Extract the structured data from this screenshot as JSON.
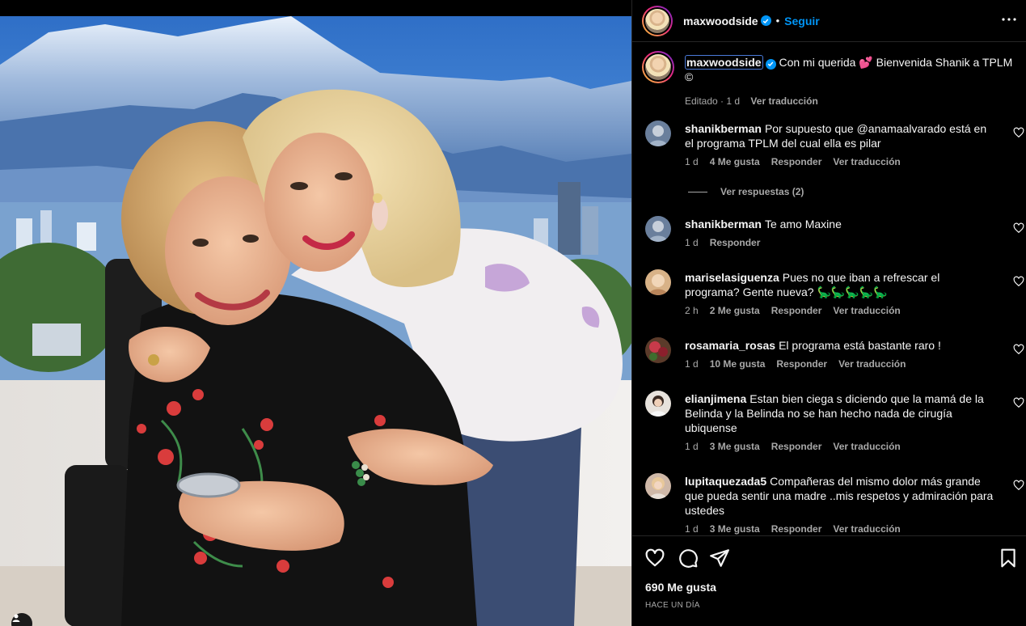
{
  "post_author": {
    "username": "maxwoodside",
    "verified": true,
    "follow_label": "Seguir",
    "separator": "•"
  },
  "caption": {
    "username": "maxwoodside",
    "text": "Con mi querida 💕 Bienvenida Shanik a TPLM ©",
    "edited_label": "Editado",
    "age": "1 d",
    "translate_label": "Ver traducción"
  },
  "comments": [
    {
      "username": "shanikberman",
      "text": "Por supuesto que @anamaalvarado está en el programa TPLM del cual ella es pilar",
      "age": "1 d",
      "likes": "4 Me gusta",
      "reply_label": "Responder",
      "translate_label": "Ver traducción",
      "avatar_color": "#6a7f9c"
    },
    {
      "username": "shanikberman",
      "text": "Te amo Maxine",
      "age": "1 d",
      "reply_label": "Responder",
      "avatar_color": "#6a7f9c"
    },
    {
      "username": "mariselasiguenza",
      "text": "Pues no que iban a refrescar el programa? Gente nueva? 🦕🦕🦕🦕🦕",
      "age": "2 h",
      "likes": "2 Me gusta",
      "reply_label": "Responder",
      "translate_label": "Ver traducción",
      "avatar_color": "#d8b287"
    },
    {
      "username": "rosamaria_rosas",
      "text": "El programa está bastante raro !",
      "age": "1 d",
      "likes": "10 Me gusta",
      "reply_label": "Responder",
      "translate_label": "Ver traducción",
      "avatar_color": "#5b3b2a"
    },
    {
      "username": "elianjimena",
      "text": "Estan bien ciega s diciendo que la mamá de la Belinda y la Belinda no se han hecho nada de cirugía ubiquense",
      "age": "1 d",
      "likes": "3 Me gusta",
      "reply_label": "Responder",
      "translate_label": "Ver traducción",
      "avatar_color": "#e7e2dc"
    },
    {
      "username": "lupitaquezada5",
      "text": "Compañeras del mismo dolor más grande que pueda sentir una madre ..mis respetos y admiración para ustedes",
      "age": "1 d",
      "likes": "3 Me gusta",
      "reply_label": "Responder",
      "translate_label": "Ver traducción",
      "avatar_color": "#cfb8a8"
    }
  ],
  "view_replies_label": "Ver respuestas (2)",
  "footer": {
    "likes": "690 Me gusta",
    "time": "Hace un día"
  },
  "colors": {
    "accent": "#0095f6",
    "muted": "#a8a8a8",
    "background": "#000000",
    "divider": "#262626"
  },
  "icons": [
    "more-options-icon",
    "verified-badge-icon",
    "heart-icon",
    "comment-icon",
    "share-icon",
    "bookmark-icon",
    "tag-user-icon"
  ]
}
